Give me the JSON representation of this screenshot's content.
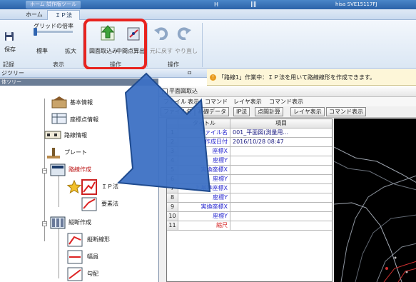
{
  "titlebar": {
    "app_tab": "ホーム    試作版ツール",
    "center": "H",
    "user": "hisa SVE15117FJ"
  },
  "ribbon_tabs": [
    "ホーム",
    "ＩＰ法"
  ],
  "ribbon": {
    "save": "保存",
    "grid_scale": "グリッドの倍率",
    "standard": "標準",
    "zoom": "拡大",
    "import": "図面取込み",
    "midpoint": "中間点算出",
    "undo": "元に戻す",
    "redo": "やり直し",
    "groups": [
      "記録",
      "表示",
      "操作",
      "操作"
    ]
  },
  "left_header": {
    "title": "ジツリー",
    "pin": "ㅁ"
  },
  "infobar": {
    "text": "「路線1」作業中：ＩＰ法を用いて路線線形を作成できます。"
  },
  "tree": {
    "header": "体ツリー",
    "items": [
      {
        "label": "基本情報"
      },
      {
        "label": "座標点情報"
      },
      {
        "label": "路線情報"
      },
      {
        "label": "プレート"
      },
      {
        "label": "路線作成"
      },
      {
        "label": "ＩＰ法"
      },
      {
        "label": "要素法"
      },
      {
        "label": "縦断作成"
      },
      {
        "label": "縦断線形"
      },
      {
        "label": "幅員"
      },
      {
        "label": "勾配"
      }
    ]
  },
  "dialog": {
    "title": "平面図取込",
    "menu": [
      "ファイル",
      "表示",
      "コマンド",
      "レイヤ表示",
      "コマンド表示"
    ],
    "tools": [
      "ファイル名",
      "基礎データ",
      "IP法",
      "点間計算",
      "レイヤ表示",
      "コマンド表示"
    ],
    "table": {
      "headers": [
        "",
        "タイトル",
        "項目"
      ],
      "rows": [
        {
          "n": "1",
          "name": "ファイル名",
          "value": "001_平面図(測量用...",
          "color": "blue"
        },
        {
          "n": "2",
          "name": "作成日付",
          "value": "2016/10/28 08:47",
          "color": "blue"
        },
        {
          "n": "3",
          "name": "座標X",
          "value": "",
          "color": "blue"
        },
        {
          "n": "4",
          "name": "座標Y",
          "value": "",
          "color": "blue"
        },
        {
          "n": "5",
          "name": "実換座標X",
          "value": "",
          "color": "blue"
        },
        {
          "n": "6",
          "name": "座標Y",
          "value": "",
          "color": "blue"
        },
        {
          "n": "7",
          "name": "2.基準座標X",
          "value": "",
          "color": "blue"
        },
        {
          "n": "8",
          "name": "座標Y",
          "value": "",
          "color": "blue"
        },
        {
          "n": "9",
          "name": "実換座標X",
          "value": "",
          "color": "blue"
        },
        {
          "n": "10",
          "name": "座標Y",
          "value": "",
          "color": "blue"
        },
        {
          "n": "11",
          "name": "縮尺",
          "value": "",
          "color": "red"
        }
      ]
    }
  },
  "colors": {
    "highlight": "#e8231f",
    "arrow": "#3d71c4",
    "arrow_border": "#1f4b8f"
  }
}
